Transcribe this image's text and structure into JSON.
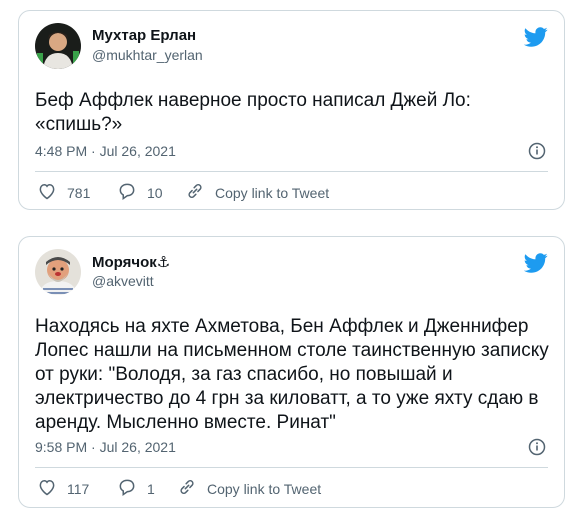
{
  "tweets": [
    {
      "author_name": "Мухтар Ерлан",
      "author_handle": "@mukhtar_yerlan",
      "text": "Беф Аффлек наверное просто написал Джей Ло: «спишь?»",
      "timestamp": "4:48 PM · Jul 26, 2021",
      "likes": "781",
      "replies": "10",
      "copy_link_label": "Copy link to Tweet"
    },
    {
      "author_name": "Морячок⚓",
      "author_handle": "@akvevitt",
      "text": "Находясь на яхте Ахметова, Бен Аффлек и Дженнифер Лопес нашли на письменном столе таинственную записку от руки: \"Володя, за газ спасибо, но повышай и электричество до 4 грн за киловатт, а то уже яхту сдаю в аренду. Мысленно вместе. Ринат\"",
      "timestamp": "9:58 PM · Jul 26, 2021",
      "likes": "117",
      "replies": "1",
      "copy_link_label": "Copy link to Tweet"
    }
  ],
  "colors": {
    "accent": "#1d9bf0",
    "muted": "#536471",
    "border": "#cfd9de"
  },
  "icons": [
    "twitter-bird-icon",
    "info-icon",
    "heart-icon",
    "reply-icon",
    "link-icon"
  ]
}
